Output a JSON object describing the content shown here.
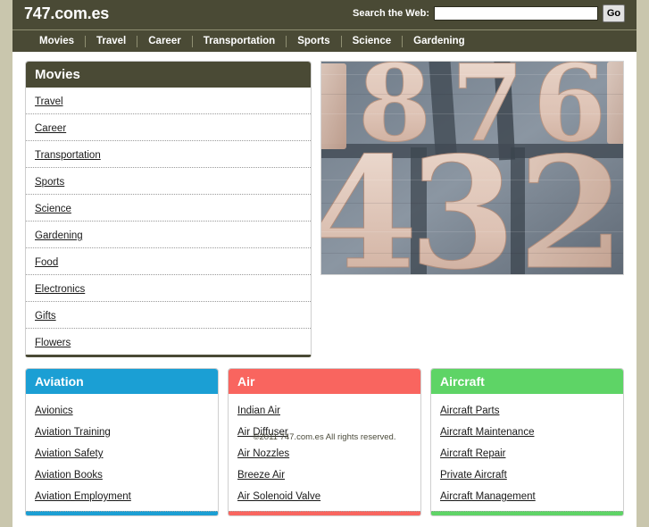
{
  "site": {
    "logo": "747.com.es",
    "accent_dark": "#4a4a35",
    "page_background": "#c9c6ad"
  },
  "search": {
    "label": "Search the Web:",
    "value": "",
    "placeholder": "",
    "button_label": "Go"
  },
  "nav": {
    "items": [
      {
        "label": "Movies"
      },
      {
        "label": "Travel"
      },
      {
        "label": "Career"
      },
      {
        "label": "Transportation"
      },
      {
        "label": "Sports"
      },
      {
        "label": "Science"
      },
      {
        "label": "Gardening"
      }
    ]
  },
  "sidebar": {
    "title": "Movies",
    "items": [
      {
        "label": "Travel"
      },
      {
        "label": "Career"
      },
      {
        "label": "Transportation"
      },
      {
        "label": "Sports"
      },
      {
        "label": "Science"
      },
      {
        "label": "Gardening"
      },
      {
        "label": "Food"
      },
      {
        "label": "Electronics"
      },
      {
        "label": "Gifts"
      },
      {
        "label": "Flowers"
      }
    ]
  },
  "hero": {
    "alt": "Letterpress wooden type blocks showing the numerals 8 7 6 4 3 2",
    "numerals": [
      "8",
      "7",
      "6",
      "4",
      "3",
      "2"
    ]
  },
  "panels": [
    {
      "title": "Aviation",
      "color": "#1b9fd4",
      "items": [
        {
          "label": "Avionics"
        },
        {
          "label": "Aviation Training"
        },
        {
          "label": "Aviation Safety"
        },
        {
          "label": "Aviation Books"
        },
        {
          "label": "Aviation Employment"
        }
      ]
    },
    {
      "title": "Air",
      "color": "#f9655f",
      "items": [
        {
          "label": "Indian Air"
        },
        {
          "label": "Air Diffuser"
        },
        {
          "label": "Air Nozzles"
        },
        {
          "label": "Breeze Air"
        },
        {
          "label": "Air Solenoid Valve"
        }
      ]
    },
    {
      "title": "Aircraft",
      "color": "#5ed466",
      "items": [
        {
          "label": "Aircraft Parts"
        },
        {
          "label": "Aircraft Maintenance"
        },
        {
          "label": "Aircraft Repair"
        },
        {
          "label": "Private Aircraft"
        },
        {
          "label": "Aircraft Management"
        }
      ]
    }
  ],
  "footer": {
    "copyright": "©2011 747.com.es All rights reserved."
  }
}
